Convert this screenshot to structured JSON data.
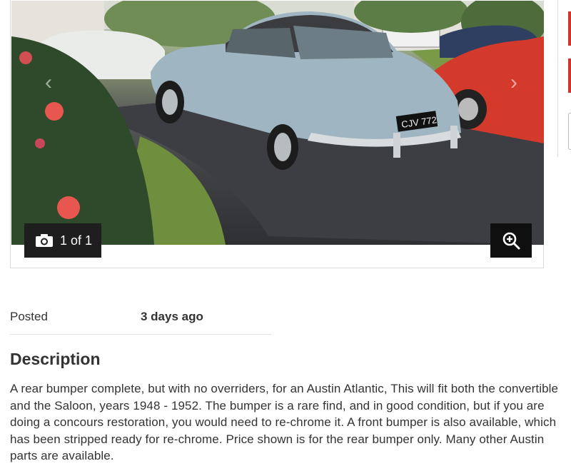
{
  "gallery": {
    "counter_label": "1 of 1",
    "icons": {
      "camera": "camera-icon",
      "zoom": "zoom-in-icon",
      "prev": "chevron-left-icon",
      "next": "chevron-right-icon"
    },
    "plate_text": "CJV 772"
  },
  "details": {
    "posted_label": "Posted",
    "posted_value": "3 days ago"
  },
  "description": {
    "title": "Description",
    "body": "A rear bumper complete, but with no overriders, for an Austin Atlantic, This will fit both the convertible and the Saloon, years 1948 - 1952. The bumper is a rare find, and in good condition, but if you are doing a concours restoration, you would need to re-chrome it. A front bumper is also available, which has been stripped ready for re-chrome. Price shown is for the rear bumper only. Many other Austin parts are available."
  },
  "colors": {
    "accent_red": "#d0342c",
    "overlay_dark": "#1e1e1e"
  }
}
